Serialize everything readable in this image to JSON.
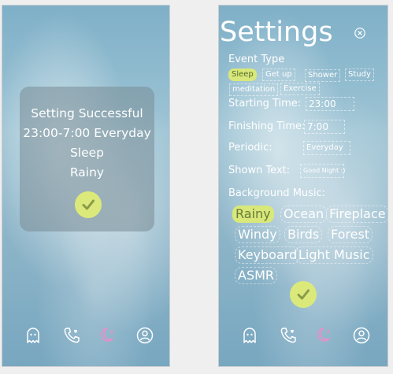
{
  "left": {
    "success": {
      "line1": "Setting Successful",
      "line2": "23:00-7:00 Everyday",
      "line3": "Sleep",
      "line4": "Rainy"
    }
  },
  "settings": {
    "title": "Settings",
    "event_type_label": "Event Type",
    "event_types": [
      "Sleep",
      "Get up",
      "Shower",
      "Study",
      "meditation",
      "Exercise"
    ],
    "selected_event": "Sleep",
    "starting_time_label": "Starting Time:",
    "starting_time_value": "23:00",
    "finishing_time_label": "Finishing Time:",
    "finishing_time_value": "7:00",
    "periodic_label": "Periodic:",
    "periodic_value": "Everyday",
    "shown_text_label": "Shown Text:",
    "shown_text_value": "Good Night :)",
    "background_music_label": "Background Music:",
    "music": [
      "Rainy",
      "Ocean",
      "Fireplace",
      "Windy",
      "Birds",
      "Forest",
      "Keyboard",
      "Light Music",
      "ASMR"
    ],
    "selected_music": "Rainy"
  },
  "nav": [
    "ghost-icon",
    "phone-heart-icon",
    "moon-icon",
    "user-icon"
  ],
  "colors": {
    "accent": "#d8e87a",
    "moon_active": "#e890c8",
    "text": "#ffffff"
  }
}
